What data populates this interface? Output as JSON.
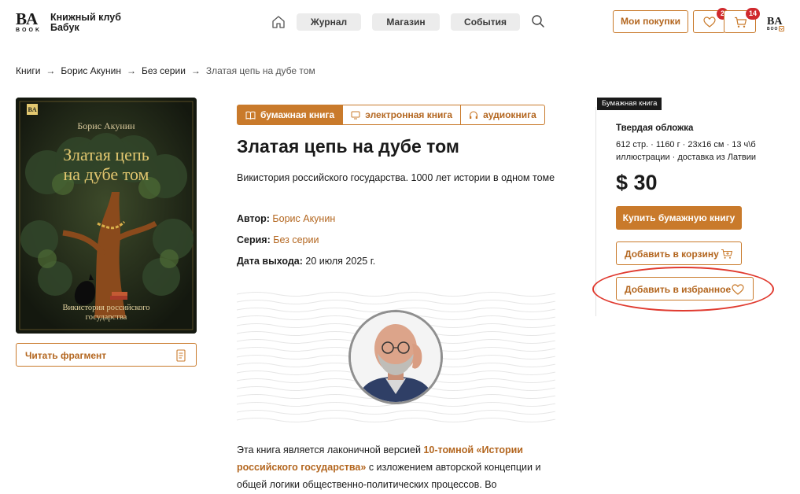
{
  "header": {
    "logo_letters": "BA",
    "logo_sub": "BOOK",
    "brand_line1": "Книжный клуб",
    "brand_line2": "Бабук",
    "nav": [
      "Журнал",
      "Магазин",
      "События"
    ],
    "my_purchases": "Мои покупки",
    "favorites_count": "2",
    "cart_count": "14"
  },
  "breadcrumb": {
    "items": [
      "Книги",
      "Борис Акунин",
      "Без серии"
    ],
    "current": "Златая цепь на дубе том",
    "separator": "→"
  },
  "cover": {
    "author": "Борис Акунин",
    "title_line1": "Златая цепь",
    "title_line2": "на дубе том",
    "subtitle_line1": "Викистория российского",
    "subtitle_line2": "государства"
  },
  "read_fragment": "Читать фрагмент",
  "format_tabs": [
    "бумажная книга",
    "электронная книга",
    "аудиокнига"
  ],
  "book": {
    "title": "Златая цепь на дубе том",
    "subtitle": "Викистория российского государства. 1000 лет истории в одном томе",
    "author_label": "Автор:",
    "author": "Борис Акунин",
    "series_label": "Серия:",
    "series": "Без серии",
    "release_label": "Дата выхода:",
    "release": "20 июля 2025 г."
  },
  "description": {
    "part1": "Эта книга является лаконичной версией ",
    "link": "10-томной «Истории российского государства»",
    "part2": " с изложением авторской концепции и общей логики общественно-политических процессов. Во"
  },
  "offer": {
    "format_tag": "Бумажная книга",
    "cover_type": "Твердая обложка",
    "specs": "612 стр. · 1160 г · 23x16 см · 13 ч\\б иллюстрации · доставка из Латвии",
    "price": "$ 30",
    "buy": "Купить бумажную книгу",
    "add_cart": "Добавить в корзину",
    "add_fav": "Добавить в избранное"
  },
  "colors": {
    "accent": "#c97a2b",
    "accent_text": "#b3661f",
    "badge": "#d0292d",
    "annotation": "#e03a2f"
  }
}
